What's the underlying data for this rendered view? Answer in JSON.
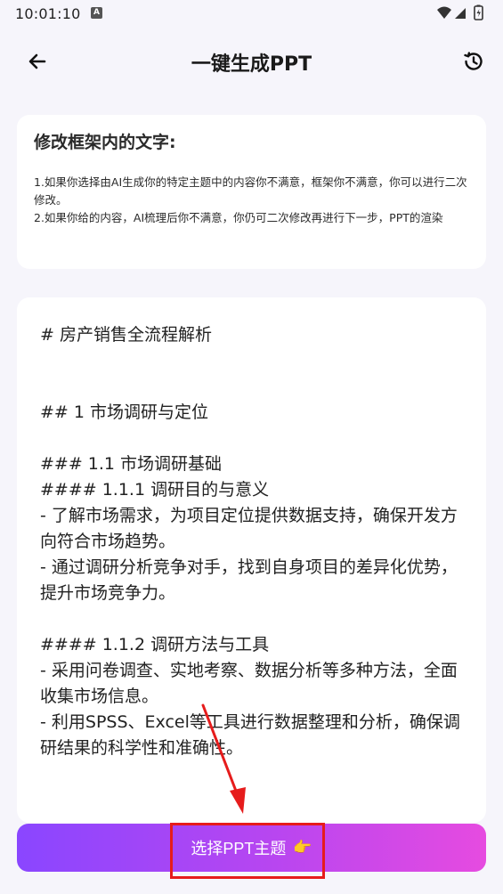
{
  "status_bar": {
    "time": "10:01:10",
    "notification_badge": "A"
  },
  "app_bar": {
    "title": "一键生成PPT",
    "back_icon": "arrow-left-icon",
    "history_icon": "history-icon"
  },
  "tips": {
    "title": "修改框架内的文字:",
    "lines": [
      "1.如果你选择由AI生成你的特定主题中的内容你不满意，框架你不满意，你可以进行二次修改。",
      "2.如果你给的内容，AI梳理后你不满意，你仍可二次修改再进行下一步，PPT的渲染"
    ]
  },
  "outline": {
    "text": "# 房产销售全流程解析\n\n\n## 1 市场调研与定位\n\n### 1.1 市场调研基础\n#### 1.1.1 调研目的与意义\n- 了解市场需求，为项目定位提供数据支持，确保开发方向符合市场趋势。\n- 通过调研分析竞争对手，找到自身项目的差异化优势，提升市场竞争力。\n\n#### 1.1.2 调研方法与工具\n- 采用问卷调查、实地考察、数据分析等多种方法，全面收集市场信息。\n- 利用SPSS、Excel等工具进行数据整理和分析，确保调研结果的科学性和准确性。"
  },
  "actions": {
    "choose_theme_label": "选择PPT主题",
    "choose_theme_emoji": "👉"
  },
  "colors": {
    "background": "#f6f5fb",
    "button_gradient_start": "#8a46ff",
    "button_gradient_end": "#e64be0",
    "annotation_red": "#e61c1c"
  }
}
